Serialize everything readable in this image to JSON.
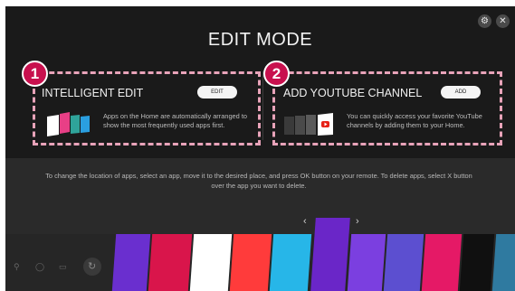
{
  "header": {
    "title": "EDIT MODE",
    "settings_icon": "gear-icon",
    "close_icon": "close-icon"
  },
  "panels": [
    {
      "badge": "1",
      "title": "INTELLIGENT EDIT",
      "button_label": "EDIT",
      "description": "Apps on the Home are automatically arranged to show the most frequently used apps first."
    },
    {
      "badge": "2",
      "title": "ADD YOUTUBE CHANNEL",
      "button_label": "ADD",
      "description": "You can quickly access your favorite YouTube channels by adding them to your Home."
    }
  ],
  "instructions": "To change the location of apps, select an app, move it to the desired place, and press OK button on your remote. To delete apps, select X button over the app you want to delete.",
  "nav": {
    "prev_glyph": "‹",
    "next_glyph": "›"
  },
  "colors": {
    "badge": "#c8104e",
    "highlight": "#e8a3b9",
    "tiles": [
      "#6a2fcf",
      "#d9154b",
      "#ffffff",
      "#ff3b3b",
      "#27b6e8",
      "#7b3fe0",
      "#5c4fd0",
      "#2a6fe0",
      "#e51966",
      "#101010",
      "#2f7aa0"
    ]
  }
}
